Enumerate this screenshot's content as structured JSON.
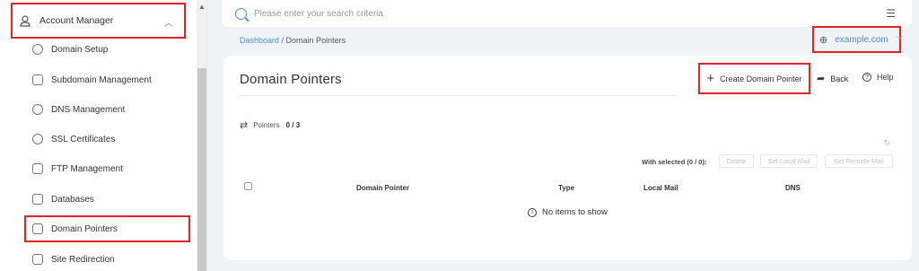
{
  "search": {
    "placeholder": "Please enter your search criteria"
  },
  "sidebar": {
    "section_label": "Account Manager",
    "items": [
      {
        "label": "Domain Setup"
      },
      {
        "label": "Subdomain Management"
      },
      {
        "label": "DNS Management"
      },
      {
        "label": "SSL Certificates"
      },
      {
        "label": "FTP Management"
      },
      {
        "label": "Databases"
      },
      {
        "label": "Domain Pointers"
      },
      {
        "label": "Site Redirection"
      }
    ]
  },
  "breadcrumb": {
    "root": "Dashboard",
    "separator": " / ",
    "current": "Domain Pointers"
  },
  "domain_selector": {
    "value": "example.com"
  },
  "page": {
    "title": "Domain Pointers",
    "create_label": "Create Domain Pointer",
    "back_label": "Back",
    "help_label": "Help",
    "pointers_label": "Pointers",
    "pointers_count": "0 / 3",
    "with_selected": "With selected (0 / 0):",
    "bulk_actions": {
      "delete": "Delete",
      "set_local": "Set Local Mail",
      "set_remote": "Set Remote Mail"
    },
    "columns": {
      "pointer": "Domain Pointer",
      "type": "Type",
      "local_mail": "Local Mail",
      "dns": "DNS"
    },
    "empty_message": "No items to show"
  },
  "colors": {
    "accent": "#4a90d9",
    "highlight": "#e0242a"
  }
}
